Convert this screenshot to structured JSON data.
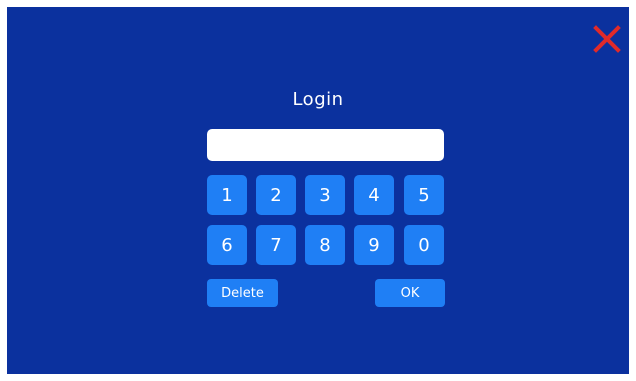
{
  "screen": {
    "title": "Login",
    "background_color": "#0b319e",
    "accent_color": "#1f7ff5",
    "close_icon": "close-x-icon",
    "close_icon_color": "#e02a2a"
  },
  "pin_input": {
    "value": "",
    "placeholder": ""
  },
  "keypad": {
    "keys": [
      "1",
      "2",
      "3",
      "4",
      "5",
      "6",
      "7",
      "8",
      "9",
      "0"
    ],
    "delete_label": "Delete",
    "ok_label": "OK"
  }
}
